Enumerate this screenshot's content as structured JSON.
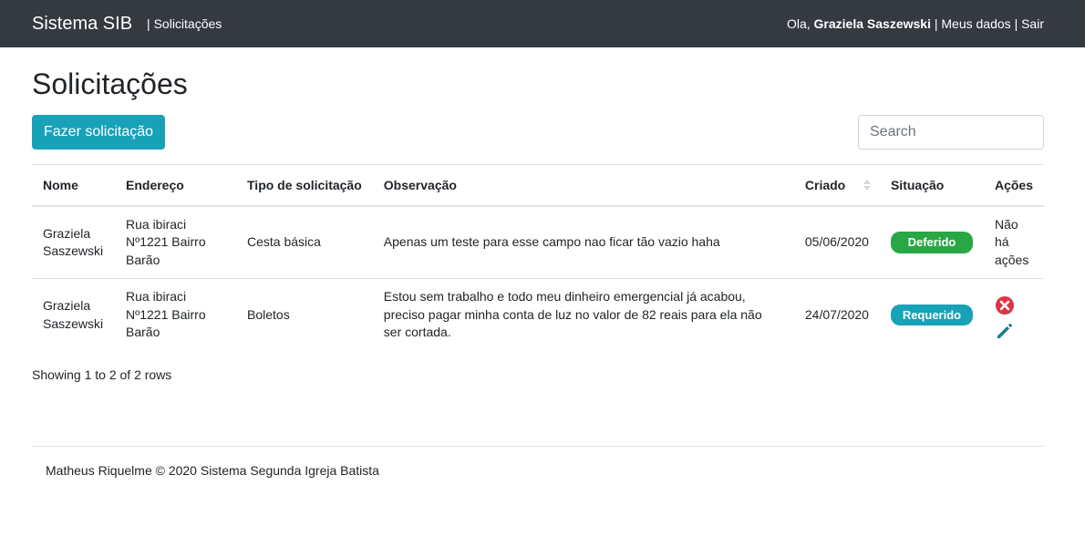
{
  "navbar": {
    "brand": "Sistema SIB",
    "separator": "|",
    "section_link": "Solicitações",
    "greeting": "Ola,",
    "user_name": "Graziela Saszewski",
    "sep1": "|",
    "my_data_link": "Meus dados",
    "sep2": "|",
    "logout_link": "Sair"
  },
  "page": {
    "title": "Solicitações",
    "new_request_button": "Fazer solicitação",
    "search_placeholder": "Search"
  },
  "table": {
    "headers": {
      "nome": "Nome",
      "endereco": "Endereço",
      "tipo": "Tipo de solicitação",
      "observacao": "Observação",
      "criado": "Criado",
      "situacao": "Situação",
      "acoes": "Ações"
    },
    "rows": [
      {
        "nome": "Graziela Saszewski",
        "endereco": "Rua ibiraci Nº1221 Bairro Barão",
        "tipo": "Cesta básica",
        "observacao": "Apenas um teste para esse campo nao ficar tão vazio haha",
        "criado": "05/06/2020",
        "situacao": "Deferido",
        "situacao_color": "#28a745",
        "acoes": "Não há ações"
      },
      {
        "nome": "Graziela Saszewski",
        "endereco": "Rua ibiraci Nº1221 Bairro Barão",
        "tipo": "Boletos",
        "observacao": "Estou sem trabalho e todo meu dinheiro emergencial já acabou, preciso pagar minha conta de luz no valor de 82 reais para ela não ser cortada.",
        "criado": "24/07/2020",
        "situacao": "Requerido",
        "situacao_color": "#17a2b8",
        "actions": [
          "delete-icon",
          "edit-icon"
        ]
      }
    ]
  },
  "pagination": {
    "info": "Showing 1 to 2 of 2 rows"
  },
  "footer": {
    "text": "Matheus Riquelme © 2020 Sistema Segunda Igreja Batista"
  },
  "colors": {
    "navbar_bg": "#343a40",
    "primary": "#17a2b8",
    "success": "#28a745",
    "danger": "#dc3545",
    "edit": "#1a7f8e"
  }
}
